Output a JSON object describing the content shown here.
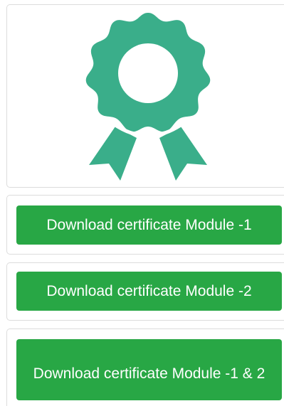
{
  "colors": {
    "accent": "#3aae8a",
    "button_bg": "#28a745",
    "button_text": "#ffffff",
    "card_border": "#dcdcdc"
  },
  "hero": {
    "icon": "award-ribbon-icon"
  },
  "buttons": [
    {
      "label": "Download certificate Module -1"
    },
    {
      "label": "Download certificate Module -2"
    },
    {
      "label": "Download certificate Module -1 & 2"
    }
  ]
}
